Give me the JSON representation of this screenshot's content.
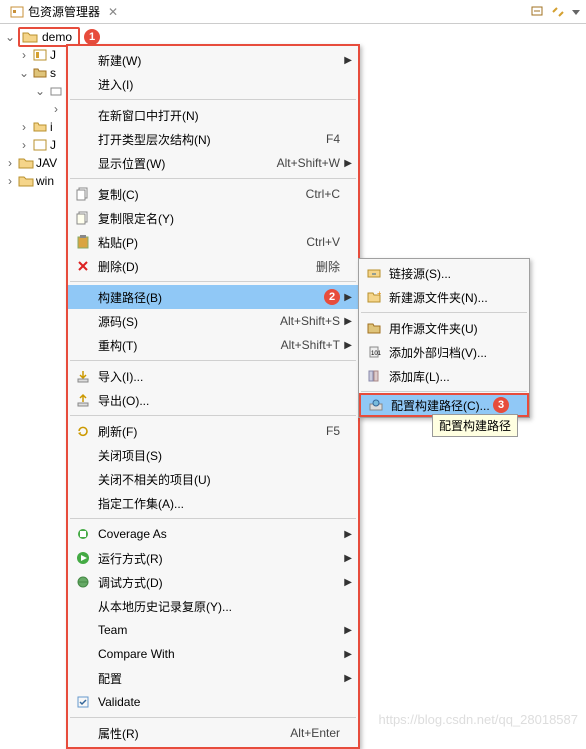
{
  "panel": {
    "title": "包资源管理器",
    "close_glyph": "✕"
  },
  "toolbar_icons": [
    "back-icon",
    "link-icon",
    "menu-icon"
  ],
  "tree": {
    "project_name": "demo",
    "callout1": "1",
    "items": [
      "J",
      "s",
      "",
      "",
      "i",
      "J",
      "JAV",
      "win"
    ]
  },
  "main_menu": [
    {
      "label": "新建(W)",
      "arrow": true,
      "icon": ""
    },
    {
      "label": "进入(I)"
    },
    {
      "sep": true
    },
    {
      "label": "在新窗口中打开(N)"
    },
    {
      "label": "打开类型层次结构(N)",
      "shortcut": "F4"
    },
    {
      "label": "显示位置(W)",
      "shortcut": "Alt+Shift+W",
      "arrow": true
    },
    {
      "sep": true
    },
    {
      "label": "复制(C)",
      "shortcut": "Ctrl+C",
      "icon": "copy"
    },
    {
      "label": "复制限定名(Y)",
      "icon": "copy-q"
    },
    {
      "label": "粘贴(P)",
      "shortcut": "Ctrl+V",
      "icon": "paste"
    },
    {
      "label": "删除(D)",
      "shortcut": "删除",
      "icon": "delete"
    },
    {
      "sep": true
    },
    {
      "label": "构建路径(B)",
      "arrow": true,
      "highlight": true,
      "callout": "2"
    },
    {
      "label": "源码(S)",
      "shortcut": "Alt+Shift+S",
      "arrow": true
    },
    {
      "label": "重构(T)",
      "shortcut": "Alt+Shift+T",
      "arrow": true
    },
    {
      "sep": true
    },
    {
      "label": "导入(I)...",
      "icon": "import"
    },
    {
      "label": "导出(O)...",
      "icon": "export"
    },
    {
      "sep": true
    },
    {
      "label": "刷新(F)",
      "shortcut": "F5",
      "icon": "refresh"
    },
    {
      "label": "关闭项目(S)"
    },
    {
      "label": "关闭不相关的项目(U)"
    },
    {
      "label": "指定工作集(A)..."
    },
    {
      "sep": true
    },
    {
      "label": "Coverage As",
      "arrow": true,
      "icon": "coverage"
    },
    {
      "label": "运行方式(R)",
      "arrow": true,
      "icon": "run"
    },
    {
      "label": "调试方式(D)",
      "arrow": true,
      "icon": "debug"
    },
    {
      "label": "从本地历史记录复原(Y)..."
    },
    {
      "label": "Team",
      "arrow": true
    },
    {
      "label": "Compare With",
      "arrow": true
    },
    {
      "label": "配置",
      "arrow": true
    },
    {
      "label": "Validate",
      "icon": "validate"
    },
    {
      "sep": true
    },
    {
      "label": "属性(R)",
      "shortcut": "Alt+Enter"
    }
  ],
  "sub_menu": [
    {
      "label": "链接源(S)...",
      "icon": "link"
    },
    {
      "label": "新建源文件夹(N)...",
      "icon": "newfolder"
    },
    {
      "sep": true
    },
    {
      "label": "用作源文件夹(U)",
      "icon": "srcfolder"
    },
    {
      "label": "添加外部归档(V)...",
      "icon": "jar"
    },
    {
      "label": "添加库(L)...",
      "icon": "lib"
    },
    {
      "sep": true
    },
    {
      "label": "配置构建路径(C)...",
      "icon": "config",
      "highlight": true,
      "redbox": true,
      "callout": "3"
    }
  ],
  "tooltip": "配置构建路径",
  "watermark": "https://blog.csdn.net/qq_28018587"
}
